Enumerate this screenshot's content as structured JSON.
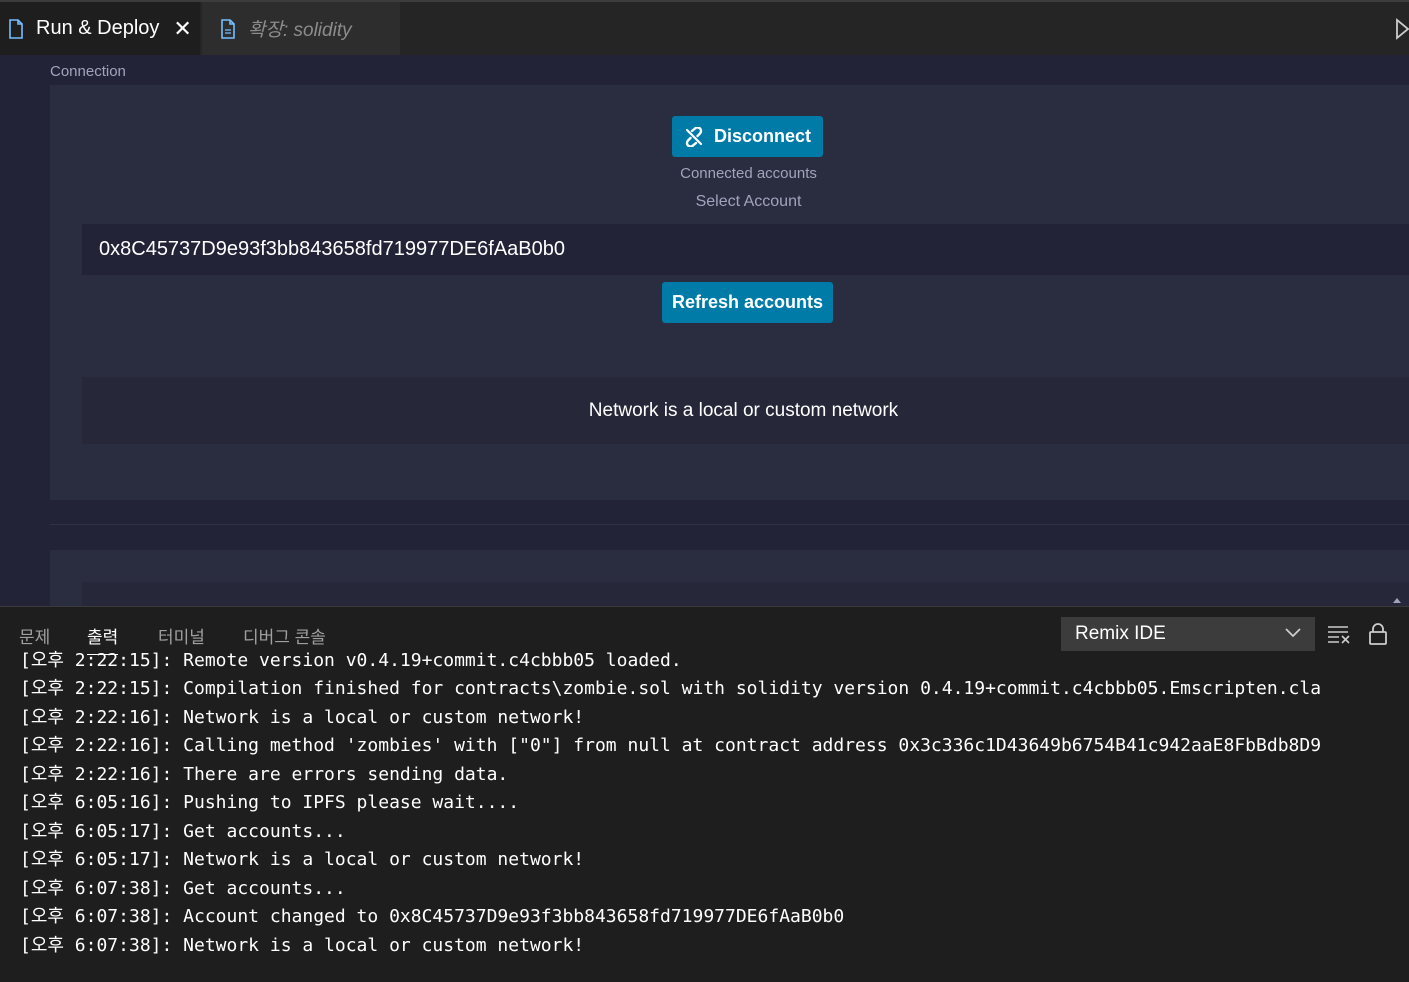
{
  "tabs": [
    {
      "label": "Run & Deploy",
      "active": true,
      "close_icon": "close-icon"
    },
    {
      "label": "확장: solidity",
      "active": false
    }
  ],
  "toolbar": {
    "run_icon": "run-icon"
  },
  "connection": {
    "section_title": "Connection",
    "disconnect_label": "Disconnect",
    "disconnect_icon": "broken-link-icon",
    "connected_accounts_label": "Connected accounts",
    "select_account_label": "Select Account",
    "account_value": "0x8C45737D9e93f3bb843658fd719977DE6fAaB0b0",
    "refresh_label": "Refresh accounts",
    "network_message": "Network is a local or custom network"
  },
  "panel": {
    "tabs": [
      "문제",
      "출력",
      "터미널",
      "디버그 콘솔"
    ],
    "active_tab": "출력",
    "output_channel": "Remix IDE",
    "icons": [
      "clear-output-icon",
      "lock-scroll-icon"
    ],
    "log_lines": [
      "[오후 2:22:15]: Remote version v0.4.19+commit.c4cbbb05 loaded.",
      "[오후 2:22:15]: Compilation finished for contracts\\zombie.sol with solidity version 0.4.19+commit.c4cbbb05.Emscripten.cla",
      "[오후 2:22:16]: Network is a local or custom network!",
      "[오후 2:22:16]: Calling method 'zombies' with [\"0\"] from null at contract address 0x3c336c1D43649b6754B41c942aaE8FbBdb8D9",
      "[오후 2:22:16]: There are errors sending data.",
      "[오후 6:05:16]: Pushing to IPFS please wait....",
      "[오후 6:05:17]: Get accounts...",
      "[오후 6:05:17]: Network is a local or custom network!",
      "[오후 6:07:38]: Get accounts...",
      "[오후 6:07:38]: Account changed to 0x8C45737D9e93f3bb843658fd719977DE6fAaB0b0",
      "[오후 6:07:38]: Network is a local or custom network!"
    ]
  },
  "colors": {
    "accent_button": "#007aa6",
    "webview_bg": "#222336",
    "card_bg": "#2a2c3f",
    "editor_bg": "#1e1e1e"
  }
}
